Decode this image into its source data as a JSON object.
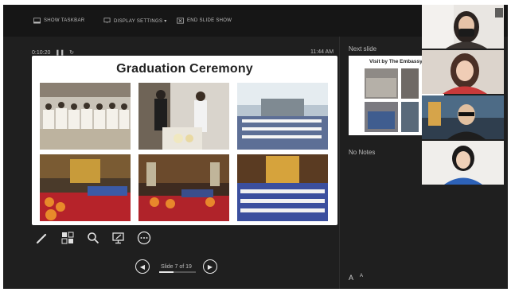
{
  "toolbar": {
    "show_taskbar": "SHOW TASKBAR",
    "display_settings": "DISPLAY SETTINGS ▾",
    "end_slide_show": "END SLIDE SHOW"
  },
  "presenter": {
    "timer": "0:10:20",
    "clock": "11:44 AM",
    "next_slide_label": "Next slide",
    "notes_label": "No Notes",
    "slide_counter": "Slide 7 of 19"
  },
  "current_slide": {
    "title": "Graduation Ceremony"
  },
  "next_slide": {
    "title": "Visit by The Embassy o"
  },
  "tools": [
    "pen-icon",
    "see-all-slides-icon",
    "zoom-icon",
    "pointer-screen-icon",
    "more-options-icon"
  ],
  "video_tiles": [
    {
      "name": "participant-1",
      "description": "woman with mask"
    },
    {
      "name": "participant-2"
    },
    {
      "name": "participant-3"
    },
    {
      "name": "participant-4"
    }
  ],
  "colors": {
    "background": "#1f1f1f",
    "toolbar": "#161616",
    "slide_bg": "#ffffff"
  }
}
